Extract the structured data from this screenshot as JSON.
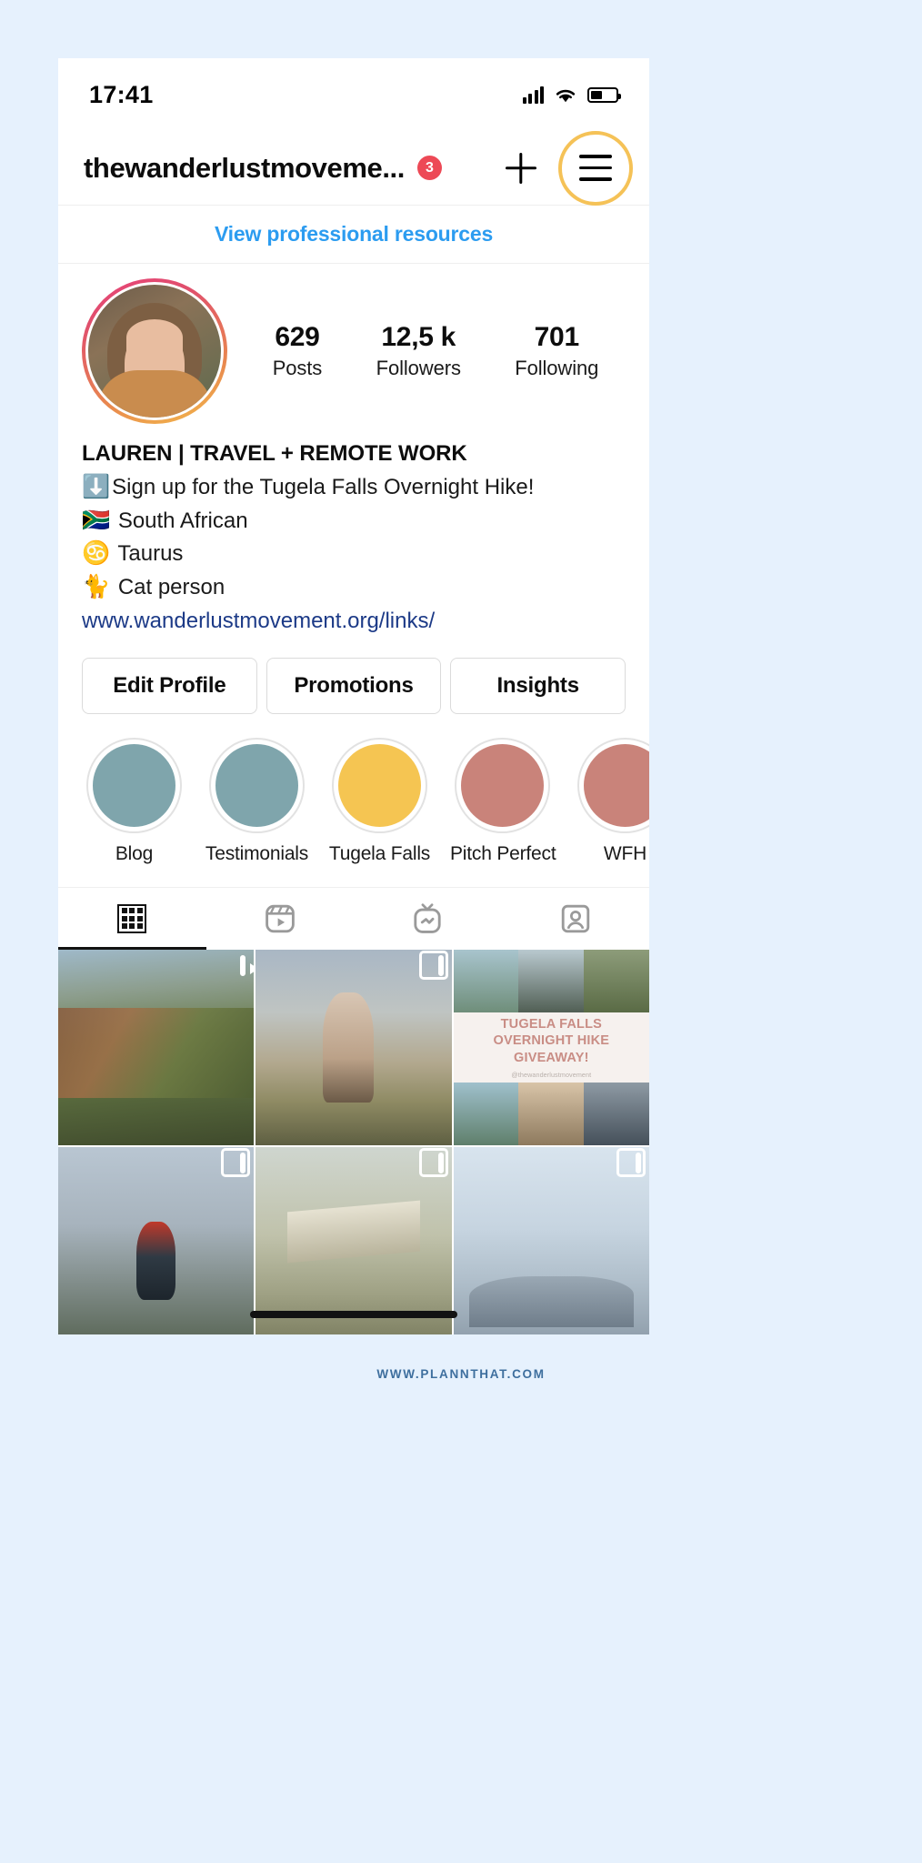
{
  "statusbar": {
    "time": "17:41",
    "signal_icon": "signal-bars-icon",
    "wifi_icon": "wifi-icon",
    "battery_icon": "battery-icon"
  },
  "header": {
    "username": "thewanderlustmoveme...",
    "badge_count": "3",
    "add_icon": "plus-icon",
    "menu_icon": "hamburger-menu-icon",
    "menu_ring_color": "#f5c257",
    "badge_color": "#ed4956"
  },
  "professional": {
    "link_label": "View professional resources",
    "link_color": "#2c9cf0"
  },
  "stats": [
    {
      "value": "629",
      "label": "Posts"
    },
    {
      "value": "12,5 k",
      "label": "Followers"
    },
    {
      "value": "701",
      "label": "Following"
    }
  ],
  "bio": {
    "display_name": "LAUREN | TRAVEL + REMOTE WORK",
    "lines": [
      {
        "emoji": "⬇️",
        "text": "Sign up for the Tugela Falls Overnight Hike!"
      },
      {
        "emoji": "🇿🇦",
        "text": "South African"
      },
      {
        "emoji": "♋️",
        "text": "Taurus"
      },
      {
        "emoji": "🐈",
        "text": "Cat person"
      }
    ],
    "website": "www.wanderlustmovement.org/links/",
    "website_color": "#1c3a87"
  },
  "actions": [
    {
      "label": "Edit Profile"
    },
    {
      "label": "Promotions"
    },
    {
      "label": "Insights"
    }
  ],
  "highlights": [
    {
      "label": "Blog",
      "color": "#7fa5ac"
    },
    {
      "label": "Testimonials",
      "color": "#7fa5ac"
    },
    {
      "label": "Tugela Falls",
      "color": "#f5c552"
    },
    {
      "label": "Pitch Perfect",
      "color": "#c9837a"
    },
    {
      "label": "WFH",
      "color": "#c9837a"
    }
  ],
  "tabs": [
    {
      "name": "grid",
      "icon": "grid-icon",
      "active": true
    },
    {
      "name": "reels",
      "icon": "reels-icon",
      "active": false
    },
    {
      "name": "igtv",
      "icon": "igtv-icon",
      "active": false
    },
    {
      "name": "tagged",
      "icon": "tagged-person-icon",
      "active": false
    }
  ],
  "posts": [
    {
      "id": "post-1",
      "overlay": "reel-icon",
      "alt": "canyon viewpoint with two people"
    },
    {
      "id": "post-2",
      "overlay": "carousel-icon",
      "alt": "woman sitting on vehicle at sunset"
    },
    {
      "id": "post-3",
      "overlay": "none",
      "alt": "giveaway announcement collage"
    },
    {
      "id": "post-4",
      "overlay": "carousel-icon",
      "alt": "hiker with red backpack"
    },
    {
      "id": "post-5",
      "overlay": "carousel-icon",
      "alt": "woman under open structure"
    },
    {
      "id": "post-6",
      "overlay": "carousel-icon",
      "alt": "mountain clouds landscape"
    }
  ],
  "giveaway": {
    "title_line1": "TUGELA FALLS",
    "title_line2": "OVERNIGHT HIKE",
    "title_line3": "GIVEAWAY!",
    "handle": "@thewanderlustmovement",
    "title_color": "#c98d85"
  },
  "bottomnav": [
    {
      "name": "home",
      "icon": "home-icon"
    },
    {
      "name": "search",
      "icon": "search-icon"
    },
    {
      "name": "reels",
      "icon": "reels-icon"
    },
    {
      "name": "shop",
      "icon": "shopping-bag-icon"
    },
    {
      "name": "profile",
      "icon": "profile-avatar-icon"
    }
  ],
  "footer": {
    "watermark": "WWW.PLANNTHAT.COM"
  }
}
